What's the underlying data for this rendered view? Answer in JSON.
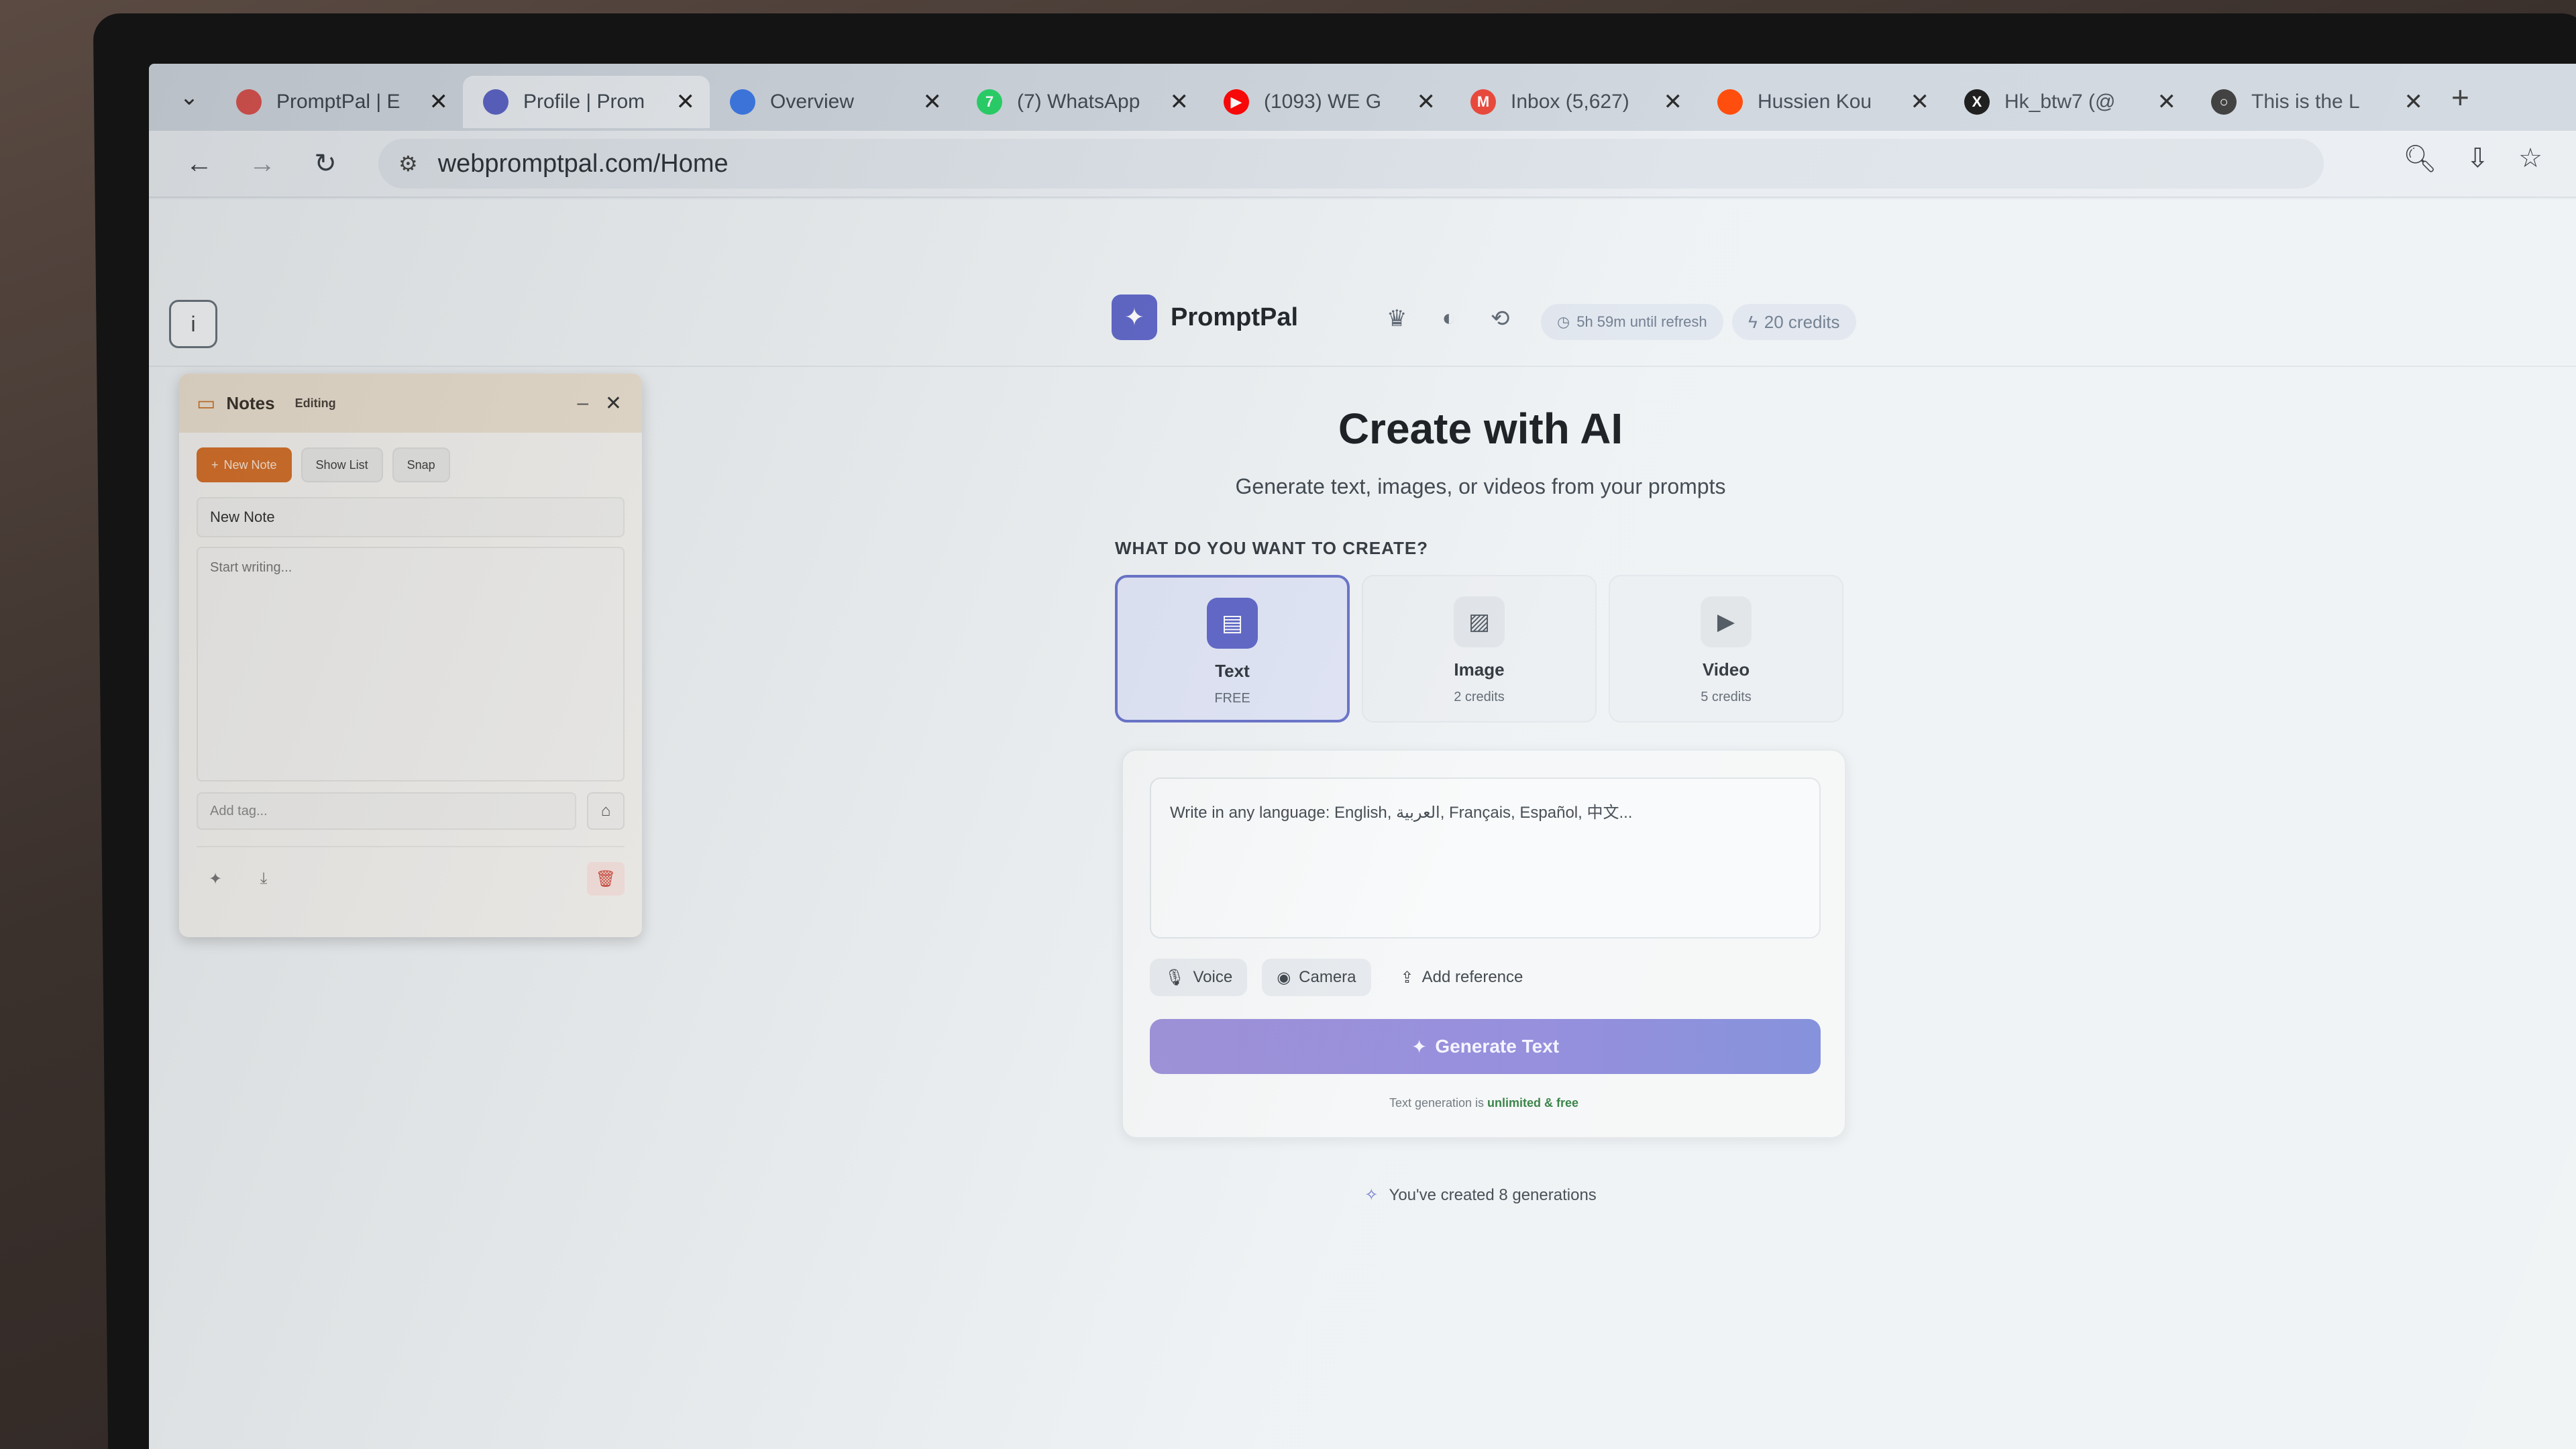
{
  "browser": {
    "tabs": [
      {
        "title": "PromptPal | E",
        "favicon_color": "#d9534f",
        "favicon_glyph": ""
      },
      {
        "title": "Profile | Prom",
        "favicon_color": "#5b63c6",
        "favicon_glyph": ""
      },
      {
        "title": "Overview",
        "favicon_color": "#3b78e7",
        "favicon_glyph": ""
      },
      {
        "title": "(7) WhatsApp",
        "favicon_color": "#25d366",
        "favicon_glyph": "7"
      },
      {
        "title": "(1093) WE G",
        "favicon_color": "#ff0000",
        "favicon_glyph": "▶"
      },
      {
        "title": "Inbox (5,627)",
        "favicon_color": "#ea4335",
        "favicon_glyph": "M"
      },
      {
        "title": "Hussien Kou",
        "favicon_color": "#ff4500",
        "favicon_glyph": ""
      },
      {
        "title": "Hk_btw7 (@",
        "favicon_color": "#111111",
        "favicon_glyph": "X"
      },
      {
        "title": "This is the L",
        "favicon_color": "#333333",
        "favicon_glyph": "○"
      }
    ],
    "active_tab_index": 1,
    "url": "webpromptpal.com/Home"
  },
  "app": {
    "brand": "PromptPal",
    "refresh_pill": "5h 59m until refresh",
    "credits_pill": "20 credits",
    "title": "Create with AI",
    "subtitle": "Generate text, images, or videos from your prompts",
    "section_label": "WHAT DO YOU WANT TO CREATE?",
    "types": [
      {
        "name": "Text",
        "cost": "FREE",
        "icon": "document-icon",
        "selected": true
      },
      {
        "name": "Image",
        "cost": "2 credits",
        "icon": "image-icon",
        "selected": false
      },
      {
        "name": "Video",
        "cost": "5 credits",
        "icon": "video-icon",
        "selected": false
      }
    ],
    "prompt_placeholder": "Write in any language: English, العربية, Français, Español, 中文...",
    "voice_label": "Voice",
    "camera_label": "Camera",
    "reference_label": "Add reference",
    "generate_label": "Generate Text",
    "note_prefix": "Text generation is ",
    "note_bold": "unlimited & free",
    "generations_text": "You've created 8 generations",
    "accent_color": "#5b63c6"
  },
  "notes": {
    "title": "Notes",
    "status": "Editing",
    "new_note_label": "New Note",
    "show_list_label": "Show List",
    "snap_label": "Snap",
    "note_title_value": "New Note",
    "body_placeholder": "Start writing...",
    "tag_placeholder": "Add tag..."
  }
}
